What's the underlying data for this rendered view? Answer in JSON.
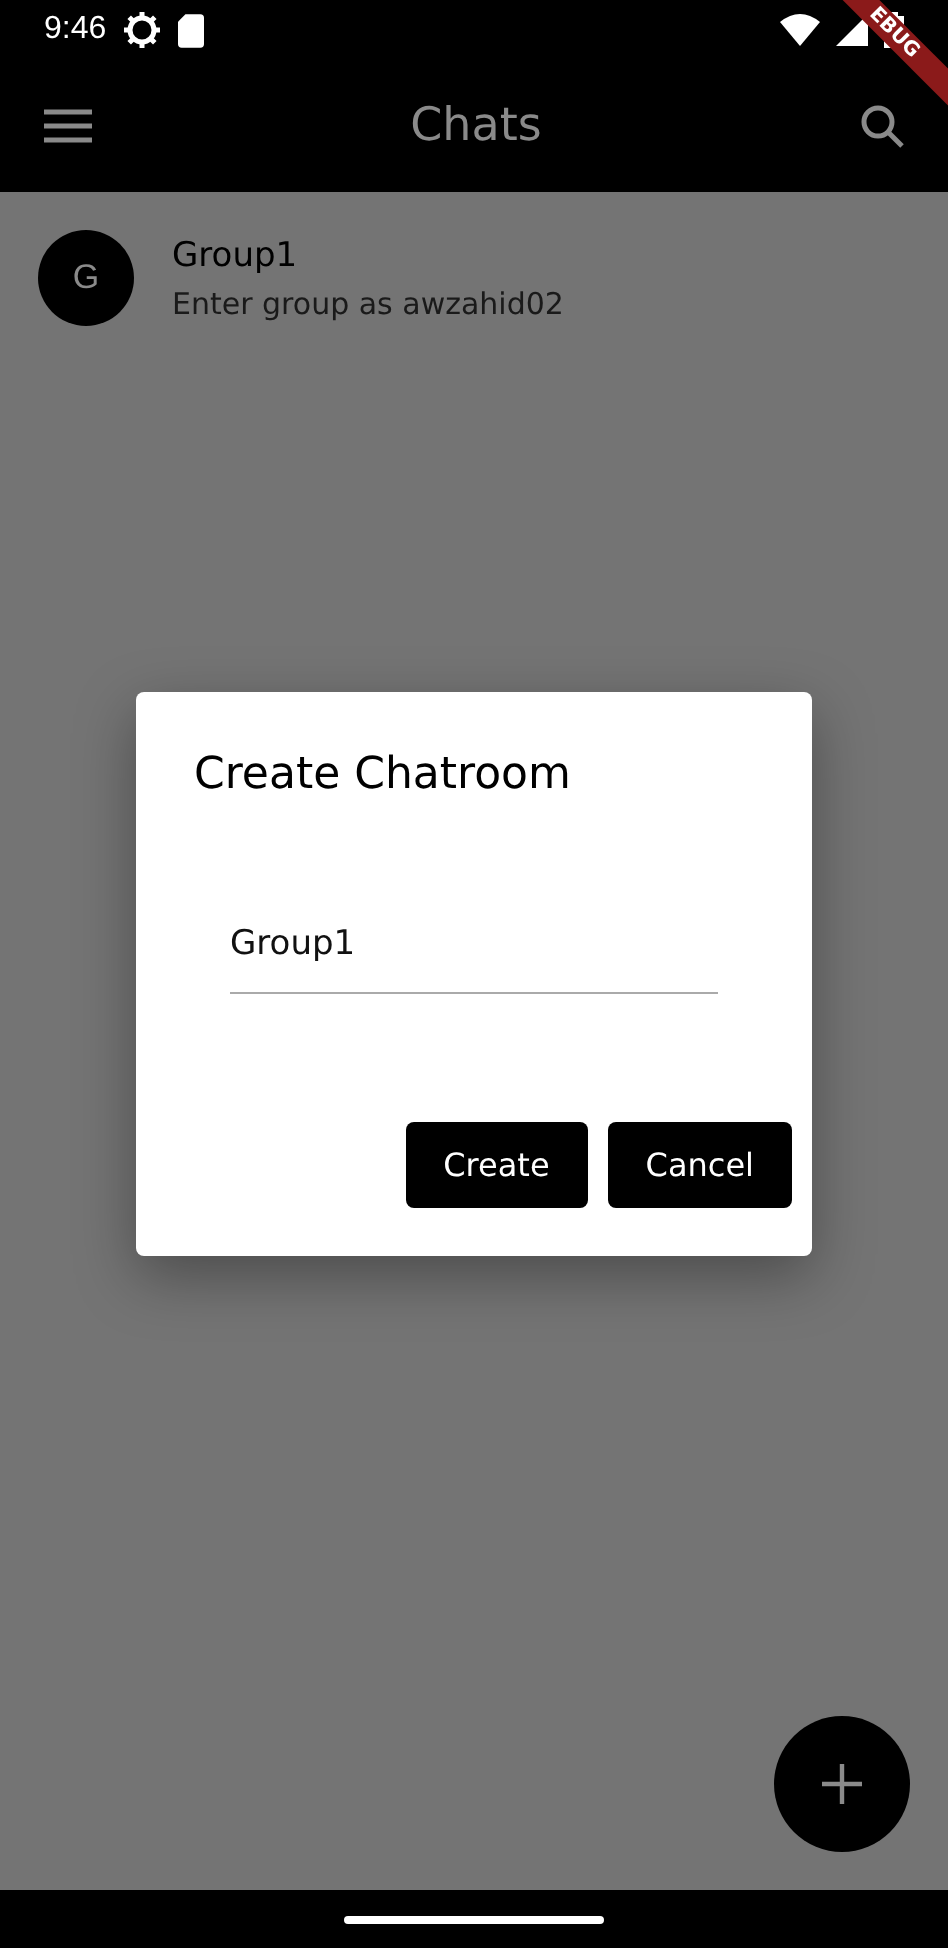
{
  "status_bar": {
    "time": "9:46"
  },
  "debug_banner": {
    "label": "EBUG"
  },
  "app_bar": {
    "title": "Chats"
  },
  "chats": [
    {
      "avatar": "G",
      "name": "Group1",
      "subtitle": "Enter group as awzahid02"
    }
  ],
  "dialog": {
    "title": "Create Chatroom",
    "field": {
      "value": "Group1"
    },
    "buttons": [
      "Create",
      "Cancel"
    ]
  }
}
